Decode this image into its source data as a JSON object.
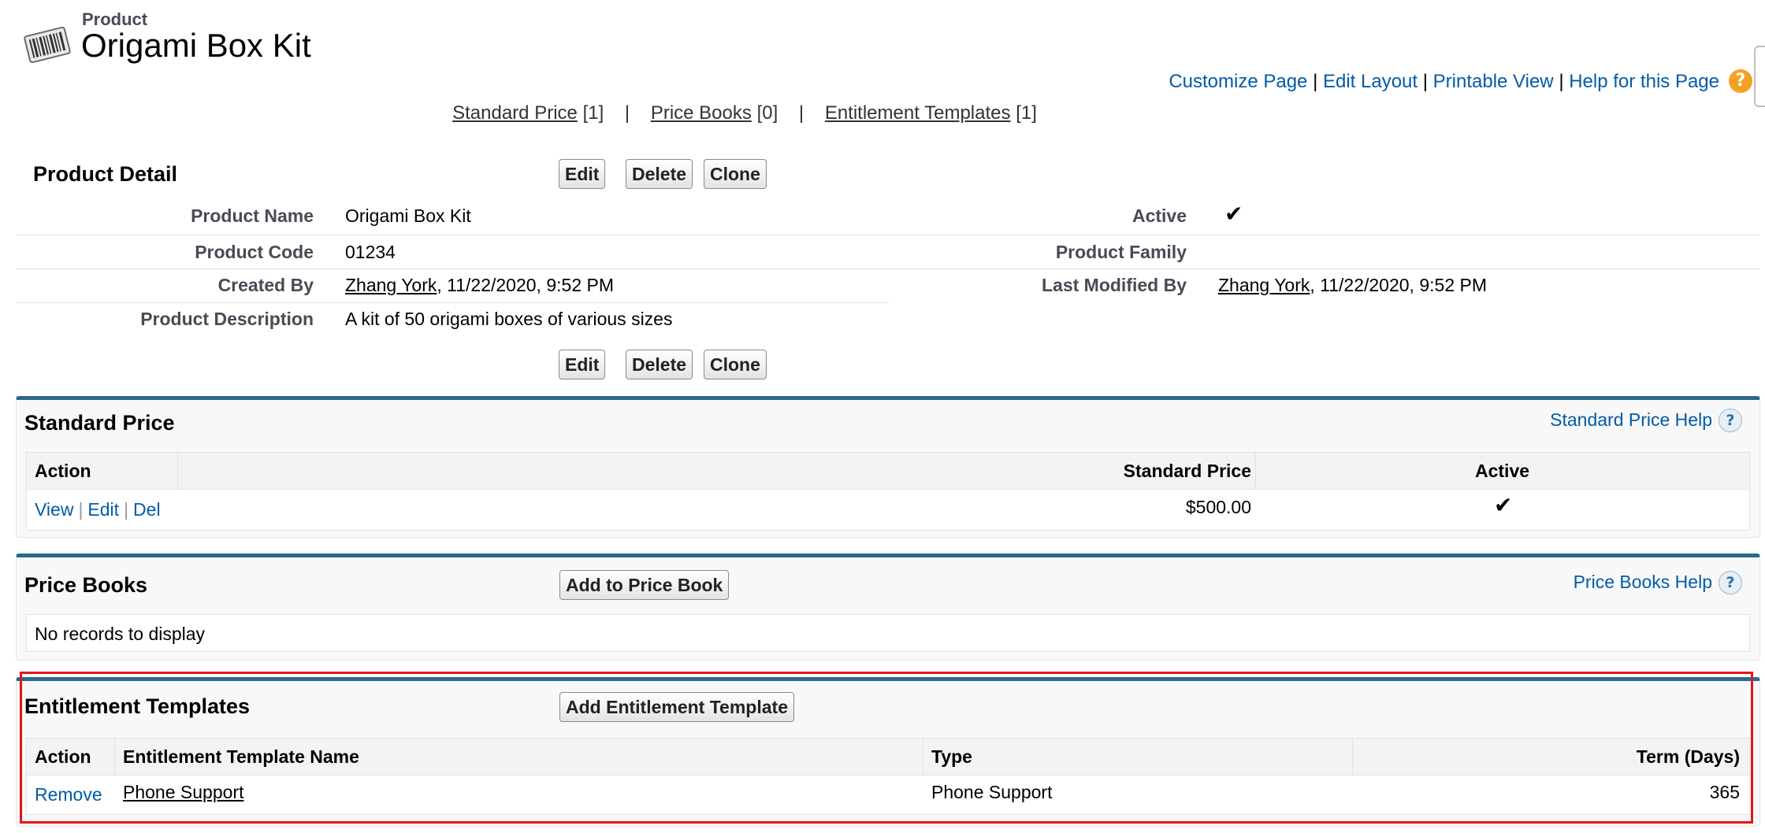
{
  "header": {
    "eyebrow": "Product",
    "title": "Origami Box Kit",
    "icon": "barcode-icon"
  },
  "top_links": {
    "customize": "Customize Page",
    "edit_layout": "Edit Layout",
    "printable": "Printable View",
    "help": "Help for this Page",
    "separator": "|",
    "help_icon": "?"
  },
  "related_links": [
    {
      "label": "Standard Price",
      "count": "[1]"
    },
    {
      "label": "Price Books",
      "count": "[0]"
    },
    {
      "label": "Entitlement Templates",
      "count": "[1]"
    }
  ],
  "detail": {
    "title": "Product Detail",
    "buttons": {
      "edit": "Edit",
      "delete": "Delete",
      "clone": "Clone"
    },
    "fields": {
      "product_name_label": "Product Name",
      "product_name": "Origami Box Kit",
      "product_code_label": "Product Code",
      "product_code": "01234",
      "created_by_label": "Created By",
      "created_by_user": "Zhang York",
      "created_by_date": ", 11/22/2020, 9:52 PM",
      "description_label": "Product Description",
      "description": "A kit of 50 origami boxes of various sizes",
      "active_label": "Active",
      "active": true,
      "product_family_label": "Product Family",
      "product_family": "",
      "last_modified_label": "Last Modified By",
      "last_modified_user": "Zhang York",
      "last_modified_date": ", 11/22/2020, 9:52 PM"
    }
  },
  "standard_price": {
    "title": "Standard Price",
    "help": "Standard Price Help",
    "columns": [
      "Action",
      "Standard Price",
      "Active"
    ],
    "rows": [
      {
        "actions": [
          "View",
          "Edit",
          "Del"
        ],
        "price": "$500.00",
        "active": true
      }
    ]
  },
  "price_books": {
    "title": "Price Books",
    "button": "Add to Price Book",
    "help": "Price Books Help",
    "empty": "No records to display"
  },
  "entitlement_templates": {
    "title": "Entitlement Templates",
    "button": "Add Entitlement Template",
    "columns": [
      "Action",
      "Entitlement Template Name",
      "Type",
      "Term (Days)"
    ],
    "rows": [
      {
        "action": "Remove",
        "name": "Phone Support",
        "type": "Phone Support",
        "term": "365"
      }
    ]
  },
  "glyphs": {
    "check": "✔",
    "help": "?"
  },
  "colors": {
    "link": "#015ba7",
    "panel_top": "#2a6a8a",
    "highlight": "#e8141b",
    "help_orange": "#f3a125"
  }
}
